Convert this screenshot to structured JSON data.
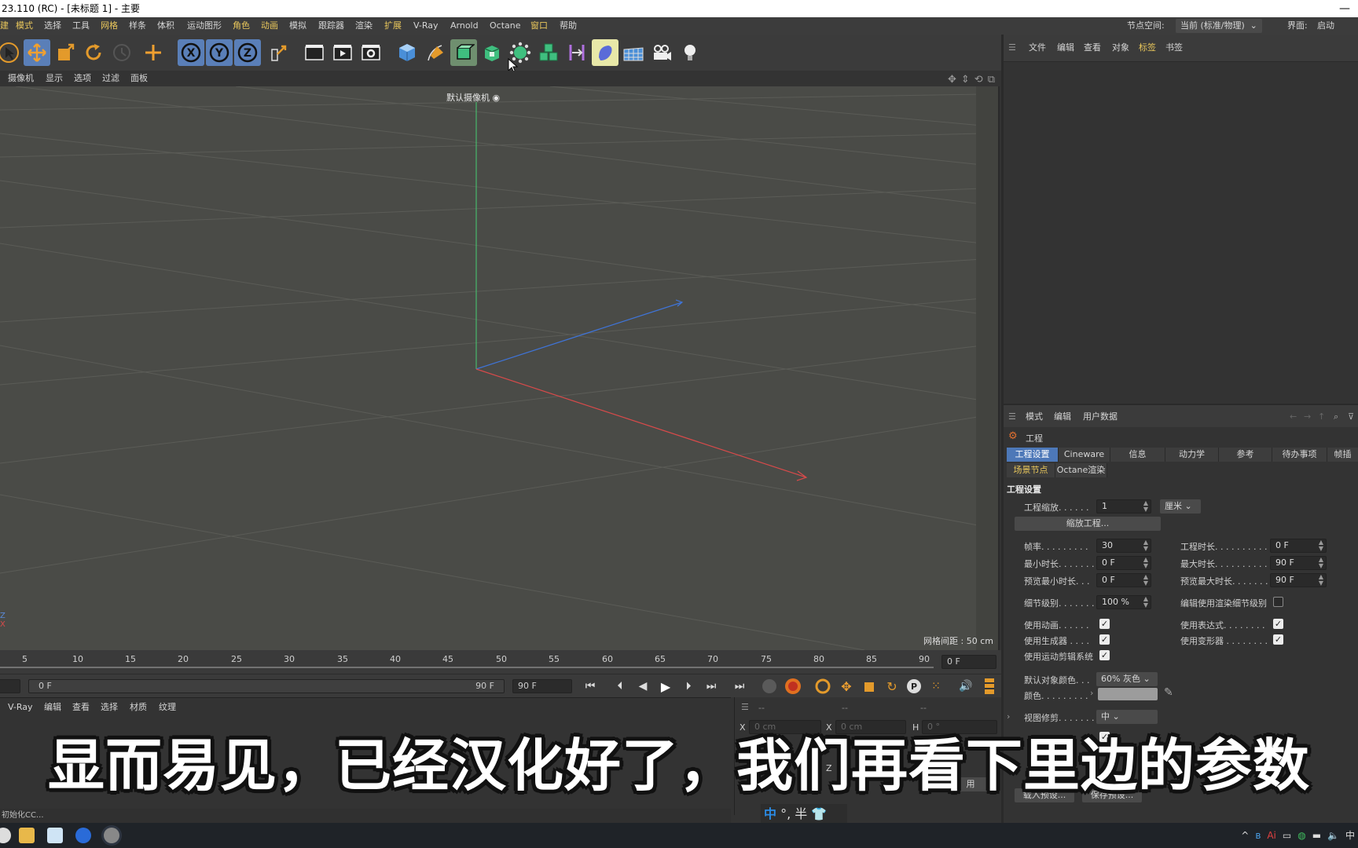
{
  "titlebar": {
    "title": "23.110 (RC) - [未标题 1] - 主要",
    "minimize": "—"
  },
  "menubar": {
    "items": [
      "建",
      "模式",
      "选择",
      "工具",
      "网格",
      "样条",
      "体积",
      "运动图形",
      "角色",
      "动画",
      "模拟",
      "跟踪器",
      "渲染",
      "扩展",
      "V-Ray",
      "Arnold",
      "Octane",
      "窗口",
      "帮助"
    ],
    "node_space_label": "节点空间:",
    "node_space_value": "当前 (标准/物理)",
    "layout_label": "界面:",
    "layout_value": "启动"
  },
  "toolbar": {
    "tools": [
      "select-icon",
      "move-icon",
      "scale-icon",
      "rotate-icon",
      "recent-icon",
      "live-select-icon",
      "x-axis-icon",
      "y-axis-icon",
      "z-axis-icon",
      "coord-system-icon",
      "render-view-icon",
      "render-picture-viewer-icon",
      "render-settings-icon",
      "cube-icon",
      "pen-icon",
      "subdivision-icon",
      "extrude-icon",
      "cloner-icon",
      "mograph-icon",
      "deformer-icon",
      "field-icon",
      "floor-icon",
      "camera-icon",
      "light-icon"
    ]
  },
  "viewmenu": {
    "items": [
      "摄像机",
      "显示",
      "选项",
      "过滤",
      "面板"
    ],
    "camera_label": "默认摄像机",
    "grid_spacing": "网格间距 : 50 cm"
  },
  "timeline": {
    "ticks": [
      "5",
      "10",
      "15",
      "20",
      "25",
      "30",
      "35",
      "40",
      "45",
      "50",
      "55",
      "60",
      "65",
      "70",
      "75",
      "80",
      "85",
      "90"
    ],
    "current_frame": "0 F"
  },
  "transport": {
    "start": "0 F",
    "end": "90 F",
    "end2": "90 F"
  },
  "matmenu": {
    "items": [
      "V-Ray",
      "编辑",
      "查看",
      "选择",
      "材质",
      "纹理"
    ]
  },
  "coords": {
    "header": [
      "--",
      "--",
      "--"
    ],
    "x1_label": "X",
    "x1_value": "0 cm",
    "x2_label": "X",
    "x2_value": "0 cm",
    "h_label": "H",
    "h_value": "0 °",
    "z_label": "Z",
    "apply_label": "用"
  },
  "statusbar": {
    "text": "初始化CC..."
  },
  "ime": {
    "mode": "中",
    "rest": "°, 半"
  },
  "subtitle": "显而易见，已经汉化好了，我们再看下里边的参数",
  "object_manager": {
    "menu": [
      "文件",
      "编辑",
      "查看",
      "对象",
      "标签",
      "书签"
    ]
  },
  "attribute_manager": {
    "menu": [
      "模式",
      "编辑",
      "用户数据"
    ],
    "object_title": "工程",
    "tabs": [
      "工程设置",
      "Cineware",
      "信息",
      "动力学",
      "参考",
      "待办事项",
      "帧插"
    ],
    "subtabs": [
      "场景节点",
      "Octane渲染"
    ],
    "section_title": "工程设置",
    "scale_label": "工程缩放. . . . . .",
    "scale_value": "1",
    "scale_unit": "厘米",
    "scale_button": "缩放工程...",
    "fps_label": "帧率. . . . . . . . .",
    "fps_value": "30",
    "doc_time_label": "工程时长. . . . . . . . . .",
    "doc_time_value": "0 F",
    "min_time_label": "最小时长. . . . . . .",
    "min_time_value": "0 F",
    "max_time_label": "最大时长. . . . . . . . . .",
    "max_time_value": "90 F",
    "prev_min_label": "预览最小时长. . .",
    "prev_min_value": "0 F",
    "prev_max_label": "预览最大时长. . . . . . .",
    "prev_max_value": "90 F",
    "lod_label": "细节级别. . . . . . .",
    "lod_value": "100 %",
    "render_lod_label": "编辑使用渲染细节级别",
    "use_anim_label": "使用动画. . . . . .",
    "use_expr_label": "使用表达式. . . . . . . .",
    "use_gen_label": "使用生成器 . . . .",
    "use_deform_label": "使用变形器 . . . . . . . .",
    "use_motion_label": "使用运动剪辑系统",
    "def_color_label": "默认对象颜色. . .",
    "def_color_value": "60% 灰色",
    "color_label": "颜色. . . . . . . . .",
    "view_clip_label": "视图修剪. . . . . . .",
    "view_clip_value": "中",
    "load_preset": "载入预设...",
    "save_preset": "保存预设..."
  },
  "tray": {
    "items": [
      "^",
      "中"
    ]
  }
}
